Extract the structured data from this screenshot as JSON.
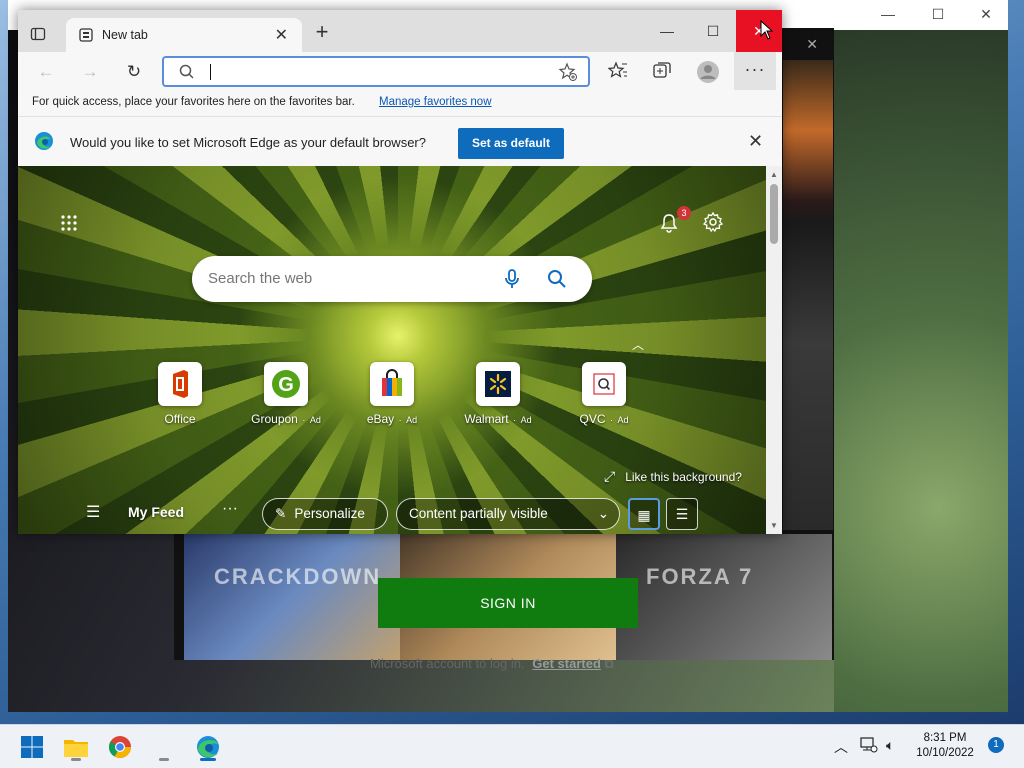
{
  "edge": {
    "tab_title": "New tab",
    "address_value": "",
    "favorites_bar": {
      "message": "For quick access, place your favorites here on the favorites bar.",
      "link": "Manage favorites now"
    },
    "default_prompt": {
      "question": "Would you like to set Microsoft Edge as your default browser?",
      "button": "Set as default"
    },
    "ntp": {
      "search_placeholder": "Search the web",
      "notification_count": "3",
      "quick_links": [
        {
          "label": "Office",
          "ad": ""
        },
        {
          "label": "Groupon",
          "ad": "Ad"
        },
        {
          "label": "eBay",
          "ad": "Ad"
        },
        {
          "label": "Walmart",
          "ad": "Ad"
        },
        {
          "label": "QVC",
          "ad": "Ad"
        }
      ],
      "like_background": "Like this background?",
      "feed_title": "My Feed",
      "personalize": "Personalize",
      "content_visibility": "Content partially visible"
    }
  },
  "xbox": {
    "signin_button": "SIGN IN",
    "signin_note": "Microsoft account to log in.",
    "get_started": "Get started",
    "tile_texts": [
      "CRACKDOWN",
      "",
      "FORZA 7"
    ]
  },
  "taskbar": {
    "time": "8:31 PM",
    "date": "10/10/2022",
    "notification_count": "1"
  },
  "colors": {
    "edge_accent": "#0f6cbd",
    "close_red": "#e81123",
    "xbox_green": "#107c10"
  }
}
